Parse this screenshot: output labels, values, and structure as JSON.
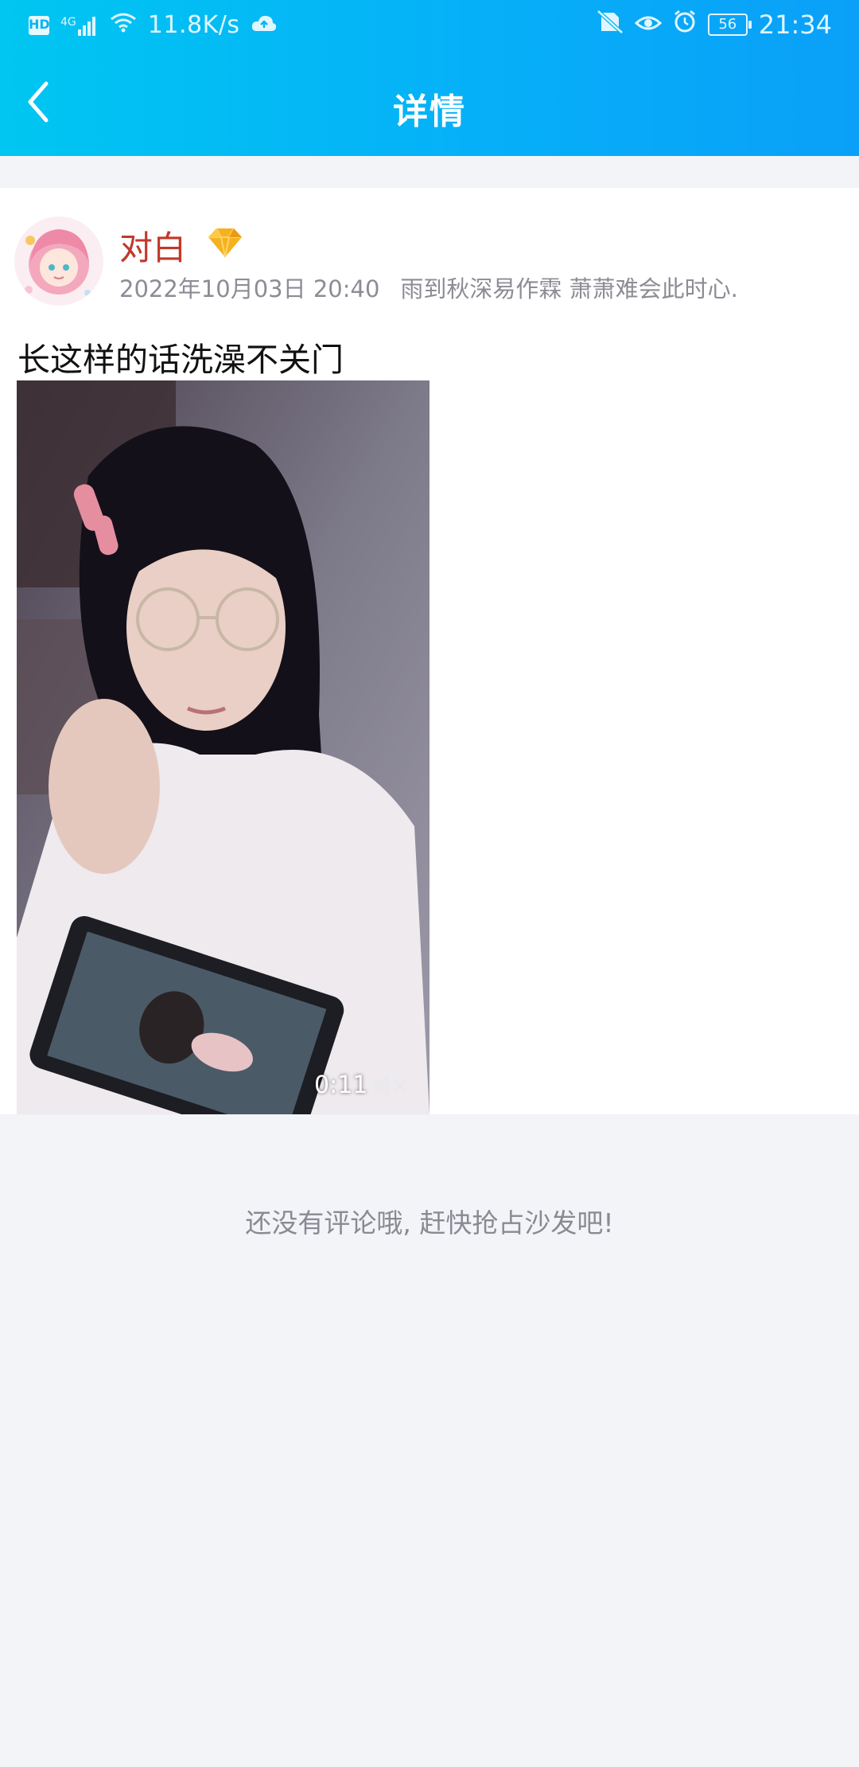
{
  "status_bar": {
    "hd_label": "HD",
    "network_label": "4G",
    "speed": "11.8K/s",
    "battery": "56",
    "time": "21:34"
  },
  "header": {
    "title": "详情",
    "gradient_start": "#00c6f1",
    "gradient_end": "#0aa0f8"
  },
  "post": {
    "author": {
      "name": "对白",
      "name_color": "#c0392b",
      "badge_icon": "diamond-icon"
    },
    "date": "2022年10月03日 20:40",
    "signature": "雨到秋深易作霖 萧萧难会此时心.",
    "text": "长这样的话洗澡不关门",
    "video": {
      "duration": "0:11",
      "muted": true
    }
  },
  "comments": {
    "empty_text": "还没有评论哦, 赶快抢占沙发吧!"
  }
}
